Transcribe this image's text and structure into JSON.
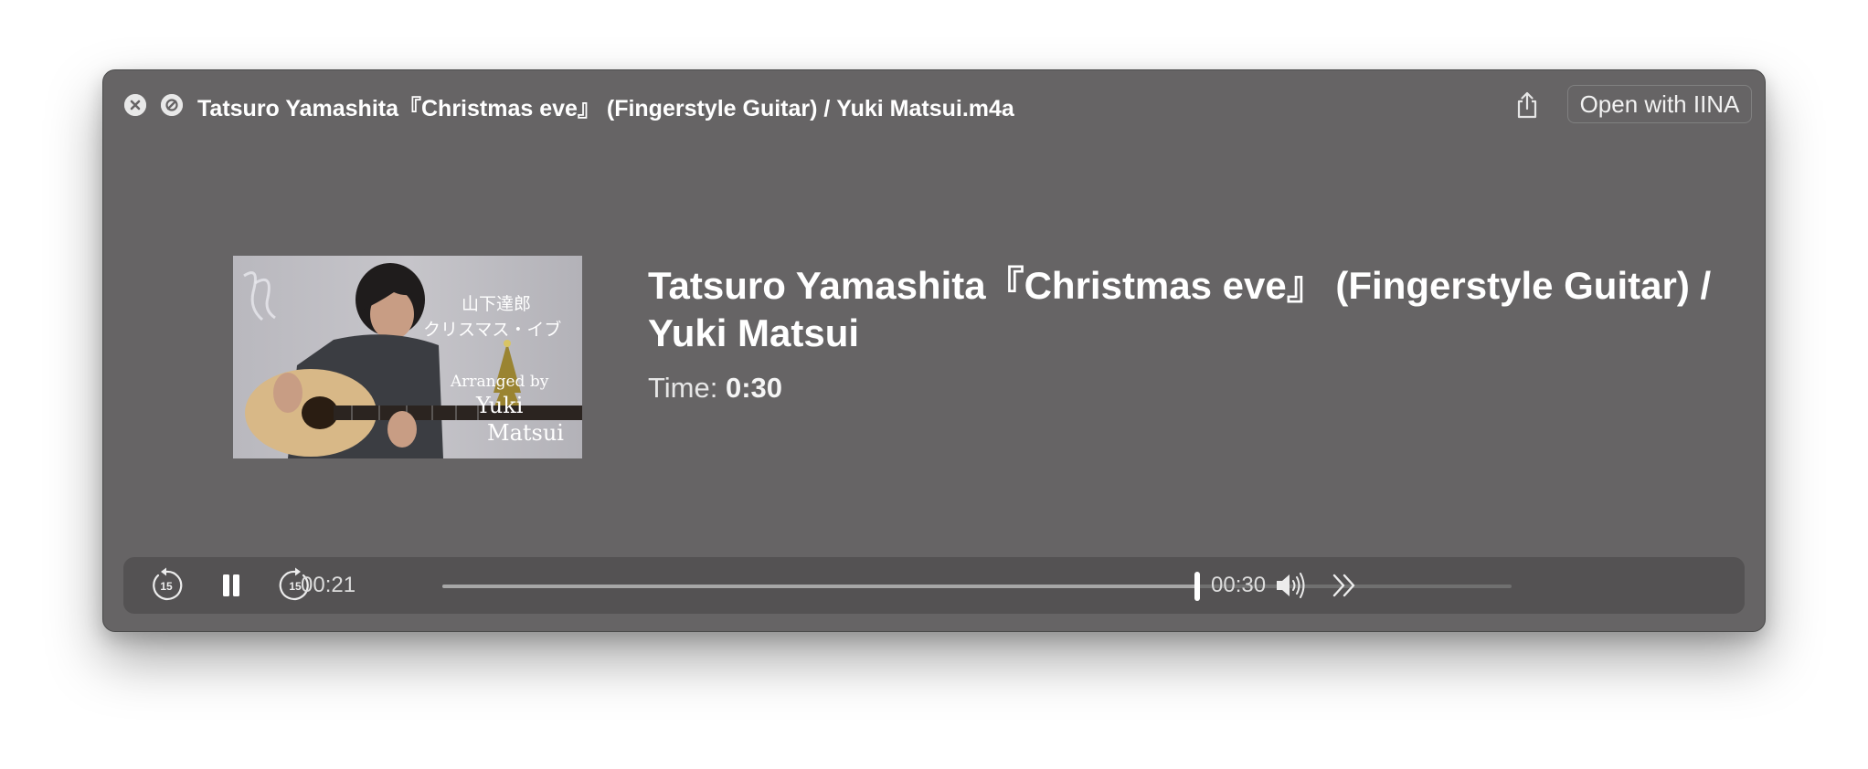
{
  "window": {
    "title": "Tatsuro Yamashita『Christmas eve』 (Fingerstyle Guitar) / Yuki Matsui.m4a",
    "open_with_label": "Open with IINA"
  },
  "artwork": {
    "monogram": "YM",
    "jp_line1": "山下達郎",
    "jp_line2": "クリスマス・イブ",
    "arranged_by": "Arranged by",
    "artist_first": "Yuki",
    "artist_last": "Matsui"
  },
  "track": {
    "title": "Tatsuro Yamashita『Christmas eve』 (Fingerstyle Guitar) / Yuki Matsui",
    "time_label": "Time:",
    "time_value": "0:30"
  },
  "player": {
    "current_time": "00:21",
    "total_time": "00:30",
    "progress": 0.706,
    "skip_back_seconds": "15",
    "skip_forward_seconds": "15",
    "state": "playing"
  },
  "icons": {
    "close": "close-icon",
    "hide": "hide-icon",
    "share": "share-icon",
    "skip_back": "skip-back-15-icon",
    "pause": "pause-icon",
    "skip_forward": "skip-forward-15-icon",
    "volume": "volume-icon",
    "more": "chevron-double-right-icon"
  }
}
